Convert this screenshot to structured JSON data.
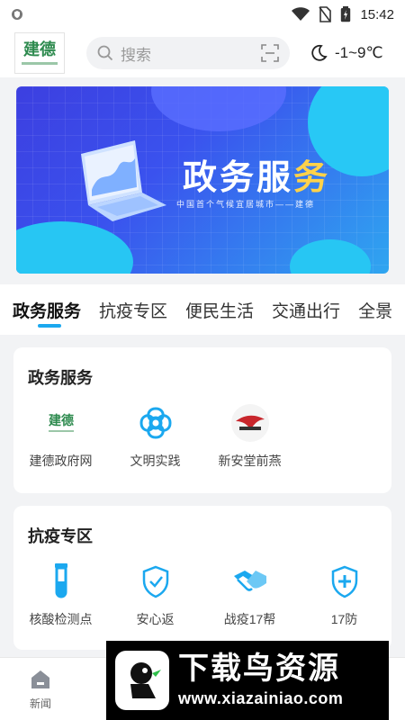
{
  "status_bar": {
    "time": "15:42"
  },
  "header": {
    "logo_text": "建德",
    "search_placeholder": "搜索",
    "weather": "-1~9℃"
  },
  "banner": {
    "title_part1": "政务服",
    "title_part2": "务",
    "subtitle": "中国首个气候宜居城市——建德"
  },
  "tabs": [
    "政务服务",
    "抗疫专区",
    "便民生活",
    "交通出行",
    "全景"
  ],
  "sections": {
    "gov": {
      "title": "政务服务",
      "items": [
        {
          "label": "建德政府网",
          "icon": "jiande-logo-icon"
        },
        {
          "label": "文明实践",
          "icon": "flower-icon"
        },
        {
          "label": "新安堂前燕",
          "icon": "swallow-logo-icon"
        }
      ]
    },
    "epidemic": {
      "title": "抗疫专区",
      "items": [
        {
          "label": "核酸检测点",
          "icon": "test-tube-icon"
        },
        {
          "label": "安心返",
          "icon": "shield-check-icon"
        },
        {
          "label": "战疫17帮",
          "icon": "handshake-icon"
        },
        {
          "label": "17防",
          "icon": "shield-plus-icon"
        }
      ]
    }
  },
  "bottom_nav": {
    "news_label": "新闻"
  },
  "watermark": {
    "title": "下载鸟资源",
    "url": "www.xiazainiao.com"
  },
  "colors": {
    "accent": "#1ba8ef",
    "banner_start": "#3c3fe0",
    "banner_end": "#2fa6f0"
  }
}
